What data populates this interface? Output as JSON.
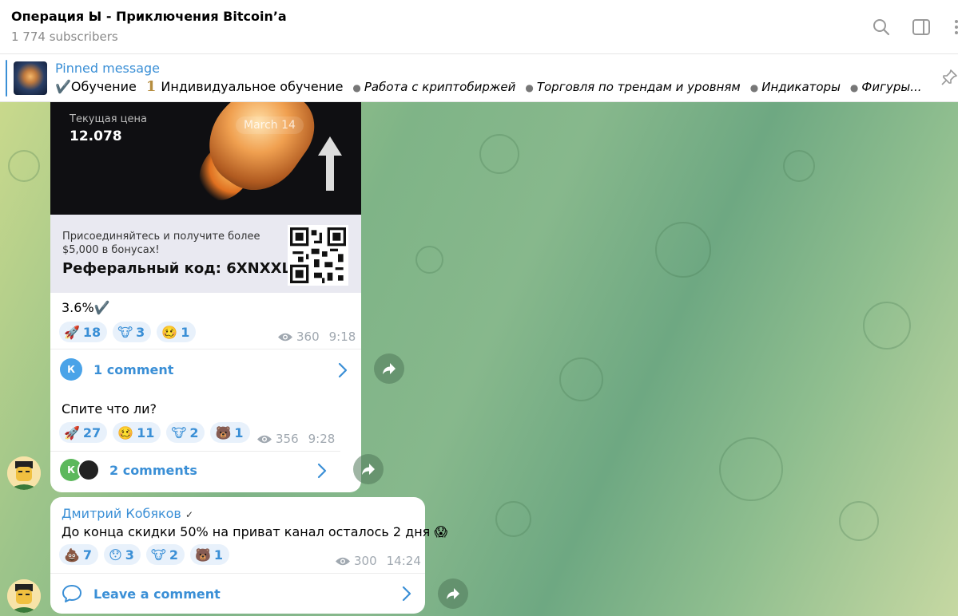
{
  "header": {
    "title": "Операция Ы - Приключения Bitcoin’a",
    "subscribers": "1 774 subscribers"
  },
  "pinned": {
    "label": "Pinned message",
    "part1": "Обучение",
    "num": "1",
    "part2": "Индивидуальное обучение",
    "items": [
      "Работа с криптобиржей",
      "Торговля по трендам и уровням",
      "Индикаторы",
      "Фигуры..."
    ]
  },
  "post1": {
    "image": {
      "price_label": "Текущая цена",
      "price": "12.078",
      "date": "March 14",
      "join_text": "Присоединяйтесь и получите более $5,000 в бонусах!",
      "ref_code": "Реферальный код: 6XNXXL"
    },
    "text": "3.6%✔️",
    "reactions": [
      {
        "emoji": "🚀",
        "count": "18"
      },
      {
        "emoji": "🐮",
        "count": "3"
      },
      {
        "emoji": "🥴",
        "count": "1"
      }
    ],
    "views": "360",
    "time": "9:18",
    "comment_avatar": "К",
    "comments": "1 comment"
  },
  "post2": {
    "text": "Спите что ли?",
    "reactions": [
      {
        "emoji": "🚀",
        "count": "27"
      },
      {
        "emoji": "🥴",
        "count": "11"
      },
      {
        "emoji": "🐮",
        "count": "2"
      },
      {
        "emoji": "🐻",
        "count": "1"
      }
    ],
    "views": "356",
    "time": "9:28",
    "comment_avatar": "К",
    "comments": "2 comments"
  },
  "post3": {
    "sender": "Дмитрий Кобяков",
    "verified": "✓",
    "text": "До конца скидки 50% на приват канал осталось 2 дня 😱",
    "reactions": [
      {
        "emoji": "💩",
        "count": "7"
      },
      {
        "emoji": "😯",
        "count": "3"
      },
      {
        "emoji": "🐮",
        "count": "2"
      },
      {
        "emoji": "🐻",
        "count": "1"
      }
    ],
    "views": "300",
    "time": "14:24",
    "comments": "Leave a comment"
  },
  "colors": {
    "accent": "#3a8fd6",
    "reaction_bg": "#e8f1fb"
  }
}
